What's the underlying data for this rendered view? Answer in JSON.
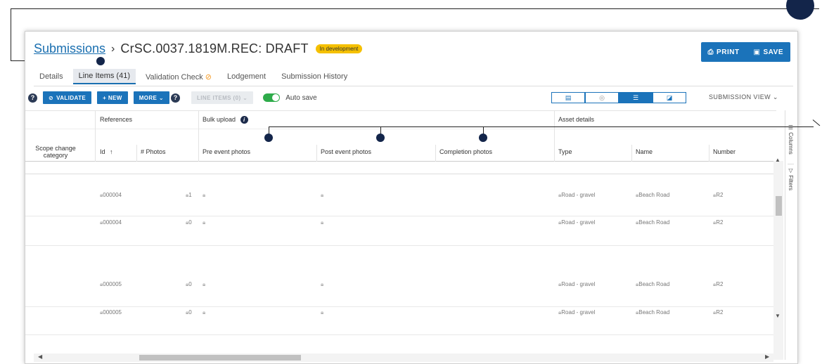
{
  "header": {
    "breadcrumb_link": "Submissions",
    "separator": "›",
    "title": "CrSC.0037.1819M.REC: DRAFT",
    "status_badge": "In development",
    "print_label": "PRINT",
    "save_label": "SAVE"
  },
  "tabs": [
    {
      "label": "Details"
    },
    {
      "label": "Line Items (41)"
    },
    {
      "label": "Validation Check"
    },
    {
      "label": "Lodgement"
    },
    {
      "label": "Submission History"
    }
  ],
  "toolbar": {
    "help": "?",
    "validate_label": "VALIDATE",
    "new_label": "+ NEW",
    "more_label": "MORE ⌄",
    "line_items_label": "LINE ITEMS (0) ⌄",
    "autosave_label": "Auto save",
    "submission_view_label": "SUBMISSION VIEW ⌄"
  },
  "grid": {
    "groups": {
      "references": "References",
      "bulk_upload": "Bulk upload",
      "asset_details": "Asset details"
    },
    "columns": {
      "scope_change": "Scope change category",
      "id": "Id",
      "id_sort": "↑",
      "photos": "# Photos",
      "pre_event": "Pre event photos",
      "post_event": "Post event photos",
      "completion": "Completion photos",
      "type": "Type",
      "name": "Name",
      "number": "Number"
    },
    "rows": [
      {
        "id": "000004",
        "photos": "1",
        "type": "Road - gravel",
        "name": "Beach Road",
        "number": "R2"
      },
      {
        "id": "000004",
        "photos": "0",
        "type": "Road - gravel",
        "name": "Beach Road",
        "number": "R2"
      },
      {
        "id": "000005",
        "photos": "0",
        "type": "Road - gravel",
        "name": "Beach Road",
        "number": "R2"
      },
      {
        "id": "000005",
        "photos": "0",
        "type": "Road - gravel",
        "name": "Beach Road",
        "number": "R2"
      }
    ]
  },
  "side": {
    "columns_label": "Columns",
    "filters_label": "Filters"
  },
  "colors": {
    "accent": "#1b73ba",
    "callout": "#13254a",
    "badge": "#f5c000",
    "toggle": "#2eab4a"
  }
}
